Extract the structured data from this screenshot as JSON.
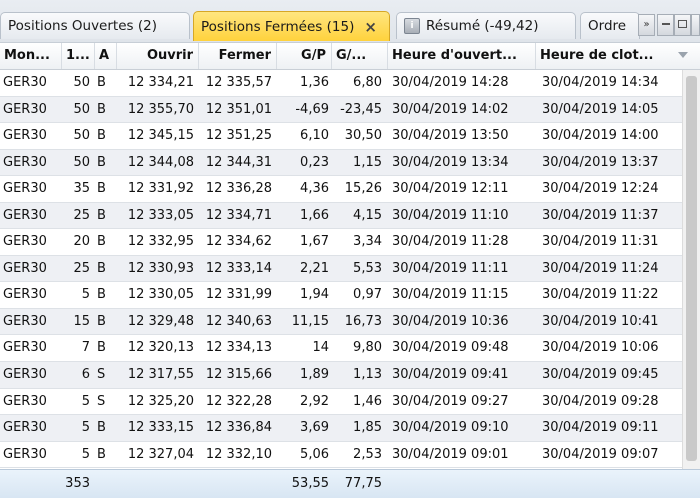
{
  "tabs": [
    {
      "label": "Positions Ouvertes (2)",
      "active": false
    },
    {
      "label": "Positions Fermées (15)",
      "active": true,
      "close": "×"
    },
    {
      "label": "Résumé (-49,42)",
      "active": false
    },
    {
      "label": "Ordre",
      "active": false
    }
  ],
  "tab_controls": {
    "overflow": "»",
    "minimize": "",
    "restore": "",
    "close": "×"
  },
  "columns": [
    {
      "key": "symbol",
      "label": "Mon..."
    },
    {
      "key": "qty",
      "label": "1..."
    },
    {
      "key": "side",
      "label": "A"
    },
    {
      "key": "open",
      "label": "Ouvrir"
    },
    {
      "key": "close",
      "label": "Fermer"
    },
    {
      "key": "pl",
      "label": "G/P"
    },
    {
      "key": "pl_total",
      "label": "G/..."
    },
    {
      "key": "opened",
      "label": "Heure d'ouvert..."
    },
    {
      "key": "closed",
      "label": "Heure de clot..."
    }
  ],
  "rows": [
    {
      "symbol": "GER30",
      "qty": "50",
      "side": "B",
      "open": "12 334,21",
      "close": "12 335,57",
      "pl": "1,36",
      "pl_total": "6,80",
      "opened": "30/04/2019 14:28",
      "closed": "30/04/2019 14:34"
    },
    {
      "symbol": "GER30",
      "qty": "50",
      "side": "B",
      "open": "12 355,70",
      "close": "12 351,01",
      "pl": "-4,69",
      "pl_total": "-23,45",
      "opened": "30/04/2019 14:02",
      "closed": "30/04/2019 14:05"
    },
    {
      "symbol": "GER30",
      "qty": "50",
      "side": "B",
      "open": "12 345,15",
      "close": "12 351,25",
      "pl": "6,10",
      "pl_total": "30,50",
      "opened": "30/04/2019 13:50",
      "closed": "30/04/2019 14:00"
    },
    {
      "symbol": "GER30",
      "qty": "50",
      "side": "B",
      "open": "12 344,08",
      "close": "12 344,31",
      "pl": "0,23",
      "pl_total": "1,15",
      "opened": "30/04/2019 13:34",
      "closed": "30/04/2019 13:37"
    },
    {
      "symbol": "GER30",
      "qty": "35",
      "side": "B",
      "open": "12 331,92",
      "close": "12 336,28",
      "pl": "4,36",
      "pl_total": "15,26",
      "opened": "30/04/2019 12:11",
      "closed": "30/04/2019 12:24"
    },
    {
      "symbol": "GER30",
      "qty": "25",
      "side": "B",
      "open": "12 333,05",
      "close": "12 334,71",
      "pl": "1,66",
      "pl_total": "4,15",
      "opened": "30/04/2019 11:10",
      "closed": "30/04/2019 11:37"
    },
    {
      "symbol": "GER30",
      "qty": "20",
      "side": "B",
      "open": "12 332,95",
      "close": "12 334,62",
      "pl": "1,67",
      "pl_total": "3,34",
      "opened": "30/04/2019 11:28",
      "closed": "30/04/2019 11:31"
    },
    {
      "symbol": "GER30",
      "qty": "25",
      "side": "B",
      "open": "12 330,93",
      "close": "12 333,14",
      "pl": "2,21",
      "pl_total": "5,53",
      "opened": "30/04/2019 11:11",
      "closed": "30/04/2019 11:24"
    },
    {
      "symbol": "GER30",
      "qty": "5",
      "side": "B",
      "open": "12 330,05",
      "close": "12 331,99",
      "pl": "1,94",
      "pl_total": "0,97",
      "opened": "30/04/2019 11:15",
      "closed": "30/04/2019 11:22"
    },
    {
      "symbol": "GER30",
      "qty": "15",
      "side": "B",
      "open": "12 329,48",
      "close": "12 340,63",
      "pl": "11,15",
      "pl_total": "16,73",
      "opened": "30/04/2019 10:36",
      "closed": "30/04/2019 10:41"
    },
    {
      "symbol": "GER30",
      "qty": "7",
      "side": "B",
      "open": "12 320,13",
      "close": "12 334,13",
      "pl": "14",
      "pl_total": "9,80",
      "opened": "30/04/2019 09:48",
      "closed": "30/04/2019 10:06"
    },
    {
      "symbol": "GER30",
      "qty": "6",
      "side": "S",
      "open": "12 317,55",
      "close": "12 315,66",
      "pl": "1,89",
      "pl_total": "1,13",
      "opened": "30/04/2019 09:41",
      "closed": "30/04/2019 09:45"
    },
    {
      "symbol": "GER30",
      "qty": "5",
      "side": "S",
      "open": "12 325,20",
      "close": "12 322,28",
      "pl": "2,92",
      "pl_total": "1,46",
      "opened": "30/04/2019 09:27",
      "closed": "30/04/2019 09:28"
    },
    {
      "symbol": "GER30",
      "qty": "5",
      "side": "B",
      "open": "12 333,15",
      "close": "12 336,84",
      "pl": "3,69",
      "pl_total": "1,85",
      "opened": "30/04/2019 09:10",
      "closed": "30/04/2019 09:11"
    },
    {
      "symbol": "GER30",
      "qty": "5",
      "side": "B",
      "open": "12 327,04",
      "close": "12 332,10",
      "pl": "5,06",
      "pl_total": "2,53",
      "opened": "30/04/2019 09:01",
      "closed": "30/04/2019 09:07"
    }
  ],
  "totals": {
    "qty": "353",
    "pl": "53,55",
    "pl_total": "77,75"
  },
  "colors": {
    "active_tab": "#ffd23c",
    "row_alt": "#eef0f4",
    "footer": "#dbe8f4"
  }
}
